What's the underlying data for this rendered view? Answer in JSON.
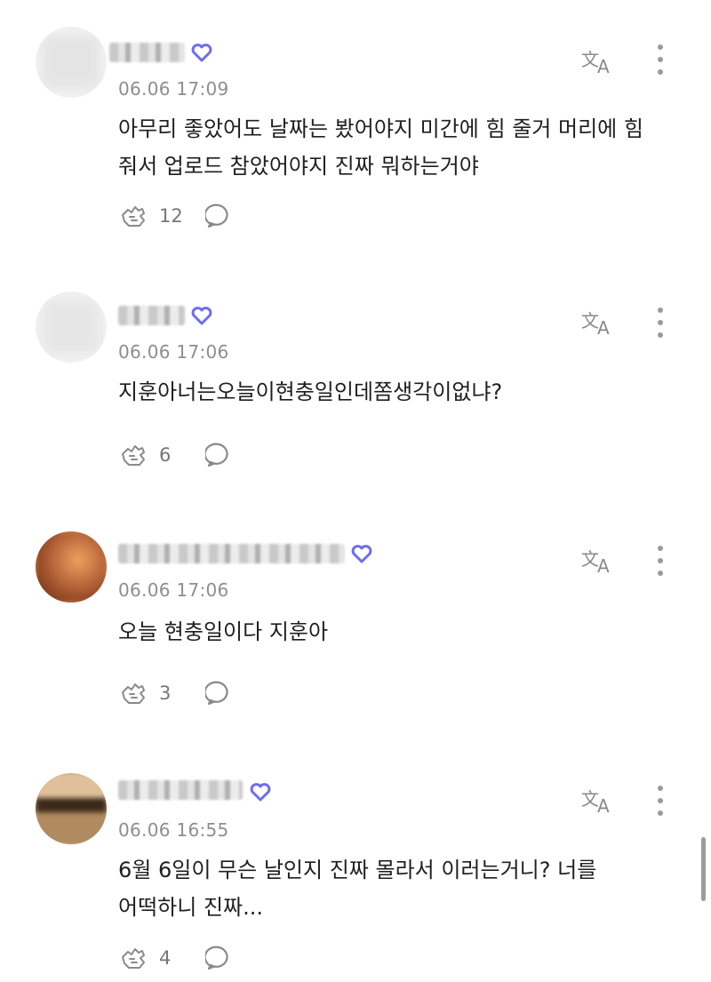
{
  "comments": [
    {
      "time": "06.06 17:09",
      "text": "아무리 좋았어도 날짜는 봤어야지 미간에 힘 줄거 머리에 힘 줘서 업로드 참았어야지 진짜 뭐하는거야",
      "likes": "12"
    },
    {
      "time": "06.06 17:06",
      "text": "지훈아너는오늘이현충일인데쫌생각이없냐?",
      "likes": "6"
    },
    {
      "time": "06.06 17:06",
      "text": "오늘 현충일이다 지훈아",
      "likes": "3"
    },
    {
      "time": "06.06 16:55",
      "text": "6월 6일이 무슨 날인지 진짜 몰라서 이러는거니? 너를 어떡하니 진짜...",
      "likes": "4"
    }
  ],
  "icons": {
    "translate": "translate-icon",
    "more": "more-vertical-icon",
    "like": "like-hand-icon",
    "reply": "reply-bubble-icon",
    "badge": "heart-badge-icon"
  },
  "colors": {
    "badge_blue": "#4f7cf0",
    "badge_purple": "#9b5cf0",
    "meta_gray": "#8e8e8e",
    "icon_gray": "#9a9a9a"
  }
}
